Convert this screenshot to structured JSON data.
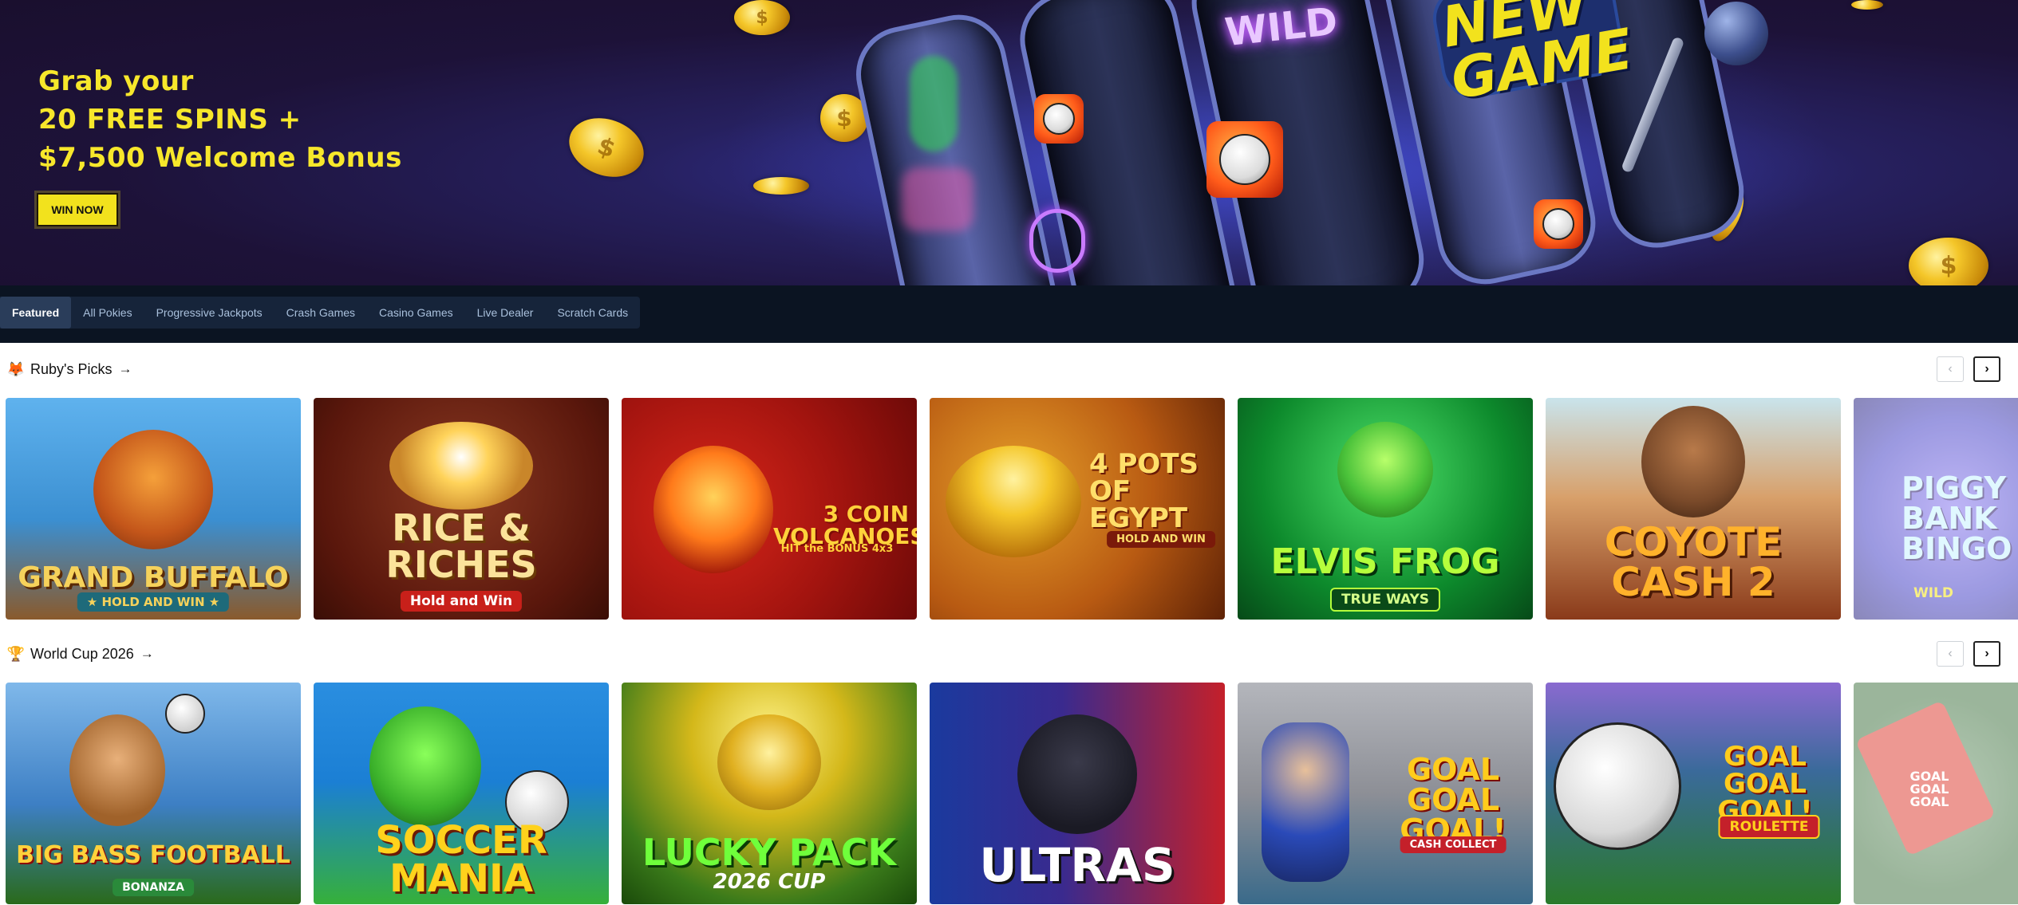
{
  "hero": {
    "headline_lines": [
      "Grab your",
      "20 FREE SPINS +",
      "$7,500 Welcome Bonus"
    ],
    "cta_label": "WIN NOW",
    "slot_wild": "WILD",
    "new_game_lines": [
      "NEW",
      "GAME"
    ],
    "coin_symbol": "$"
  },
  "nav": {
    "tabs": [
      {
        "label": "Featured",
        "active": true
      },
      {
        "label": "All Pokies",
        "active": false
      },
      {
        "label": "Progressive Jackpots",
        "active": false
      },
      {
        "label": "Crash Games",
        "active": false
      },
      {
        "label": "Casino Games",
        "active": false
      },
      {
        "label": "Live Dealer",
        "active": false
      },
      {
        "label": "Scratch Cards",
        "active": false
      }
    ]
  },
  "sections": [
    {
      "title": "Ruby's Picks",
      "icon": "ruby-mascot-icon",
      "arrow": "→",
      "prev": "‹",
      "next": "›",
      "games": [
        {
          "title": "GRAND BUFFALO",
          "sub": "★ HOLD AND WIN ★",
          "bg": "#3b8fd1",
          "accent": "#f2c94c"
        },
        {
          "title": "RICE & RICHES",
          "sub": "Hold and Win",
          "bg": "#6a1d12",
          "accent": "#f5d27a"
        },
        {
          "title": "3 COIN VOLCANOES",
          "sub": "HIT the BONUS 4x3",
          "bg": "#a3140f",
          "accent": "#ffd23b"
        },
        {
          "title": "4 POTS OF EGYPT",
          "sub": "HOLD AND WIN",
          "bg": "#a84a10",
          "accent": "#ffcf4a"
        },
        {
          "title": "ELVIS FROG",
          "sub": "TRUE WAYS",
          "bg": "#0d8a2c",
          "accent": "#b6ff3c"
        },
        {
          "title": "COYOTE CASH 2",
          "sub": "",
          "bg": "#b85a2a",
          "accent": "#ffb22b"
        },
        {
          "title": "PIGGY BANK BINGO",
          "sub": "WILD",
          "bg": "#4b47c8",
          "accent": "#7ee7ff"
        }
      ]
    },
    {
      "title": "World Cup 2026",
      "icon": "trophy-icon",
      "arrow": "→",
      "prev": "‹",
      "next": "›",
      "games": [
        {
          "title": "BIG BASS FOOTBALL",
          "sub": "BONANZA",
          "bg": "#3d7fc4",
          "accent": "#ffd23b"
        },
        {
          "title": "SOCCER MANIA",
          "sub": "",
          "bg": "#1b7fd4",
          "accent": "#ffd21c"
        },
        {
          "title": "LUCKY PACK",
          "sub": "2026 CUP",
          "bg": "#4a9b2a",
          "accent": "#6fff3b"
        },
        {
          "title": "ULTRAS",
          "sub": "",
          "bg": "#1a3a9e",
          "accent": "#ffffff"
        },
        {
          "title": "GOAL GOAL GOAL!",
          "sub": "CASH COLLECT",
          "bg": "#8d8f96",
          "accent": "#ffcc1c"
        },
        {
          "title": "GOAL GOAL GOAL!",
          "sub": "ROULETTE",
          "bg": "#3a6a3a",
          "accent": "#ffcc1c"
        },
        {
          "title": "GOAL GOAL GOAL",
          "sub": "",
          "bg": "#5f8a5f",
          "accent": "#e0453a"
        }
      ]
    }
  ]
}
